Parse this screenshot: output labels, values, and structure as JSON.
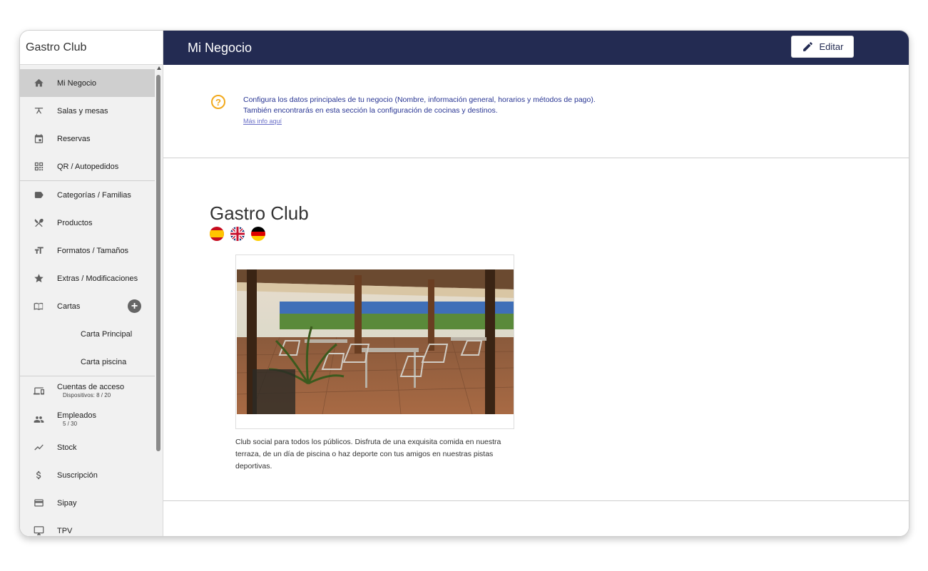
{
  "sidebar": {
    "brand": "Gastro Club",
    "items": [
      {
        "label": "Mi Negocio",
        "icon": "home-icon"
      },
      {
        "label": "Salas y mesas",
        "icon": "table-icon"
      },
      {
        "label": "Reservas",
        "icon": "calendar-icon"
      },
      {
        "label": "QR / Autopedidos",
        "icon": "qr-code-icon"
      },
      {
        "label": "Categorías / Familias",
        "icon": "label-icon"
      },
      {
        "label": "Productos",
        "icon": "utensils-icon"
      },
      {
        "label": "Formatos / Tamaños",
        "icon": "text-size-icon"
      },
      {
        "label": "Extras / Modificaciones",
        "icon": "star-icon"
      },
      {
        "label": "Cartas",
        "icon": "menu-book-icon"
      },
      {
        "label": "Carta Principal"
      },
      {
        "label": "Carta piscina"
      },
      {
        "label": "Cuentas de acceso",
        "sub": "Dispositivos: 8 / 20",
        "icon": "devices-icon"
      },
      {
        "label": "Empleados",
        "sub": "5 / 30",
        "icon": "people-icon"
      },
      {
        "label": "Stock",
        "icon": "trend-icon"
      },
      {
        "label": "Suscripción",
        "icon": "dollar-icon"
      },
      {
        "label": "Sipay",
        "icon": "credit-card-icon"
      },
      {
        "label": "TPV",
        "icon": "monitor-icon"
      }
    ]
  },
  "header": {
    "title": "Mi Negocio",
    "edit_label": "Editar"
  },
  "info": {
    "line1": "Configura los datos principales de tu negocio (Nombre, información general, horarios y métodos de pago).",
    "line2": "También encontrarás en esta sección la configuración de cocinas y destinos.",
    "link": "Más info aquí"
  },
  "business": {
    "name": "Gastro Club",
    "languages": [
      "Español",
      "English",
      "Deutsch"
    ],
    "description": "Club social para todos los públicos. Disfruta de una exquisita comida en nuestra terraza, de un día de piscina o haz deporte con tus amigos en nuestras pistas deportivas."
  },
  "colors": {
    "header_bg": "#232b52",
    "accent_warning": "#f2a91c",
    "info_text": "#283593"
  }
}
